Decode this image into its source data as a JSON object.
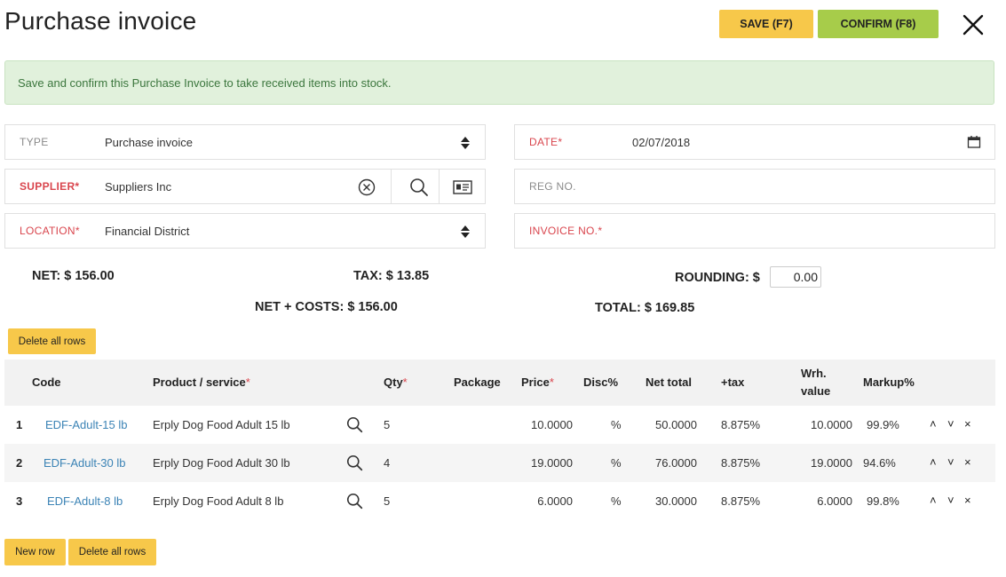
{
  "header": {
    "title": "Purchase invoice",
    "save_label": "SAVE (F7)",
    "confirm_label": "CONFIRM (F8)"
  },
  "alert": {
    "text": "Save and confirm this Purchase Invoice to take received items into stock."
  },
  "form": {
    "type": {
      "label": "TYPE",
      "value": "Purchase invoice"
    },
    "supplier": {
      "label": "SUPPLIER",
      "required_mark": "*",
      "value": "Suppliers Inc"
    },
    "location": {
      "label": "LOCATION",
      "required_mark": "*",
      "value": "Financial District"
    },
    "date": {
      "label": "DATE",
      "required_mark": "*",
      "value": "02/07/2018"
    },
    "reg_no": {
      "label": "REG NO.",
      "value": ""
    },
    "invoice_no": {
      "label": "INVOICE NO.",
      "required_mark": "*",
      "value": ""
    }
  },
  "totals": {
    "net": "NET: $ 156.00",
    "tax": "TAX: $ 13.85",
    "rounding_label": "ROUNDING: $",
    "rounding_value": "0.00",
    "net_costs": "NET + COSTS: $ 156.00",
    "total": "TOTAL: $ 169.85"
  },
  "buttons": {
    "delete_all_top": "Delete all rows",
    "new_row": "New row",
    "delete_all_bottom": "Delete all rows"
  },
  "table": {
    "headers": {
      "code": "Code",
      "product": "Product / service",
      "qty": "Qty",
      "package": "Package",
      "price": "Price",
      "disc": "Disc%",
      "net_total": "Net total",
      "tax": "+tax",
      "wrh_value_1": "Wrh.",
      "wrh_value_2": "value",
      "markup": "Markup%",
      "required_mark": "*"
    },
    "rows": [
      {
        "num": "1",
        "code": "EDF-Adult-15 lb",
        "product": "Erply Dog Food Adult 15 lb",
        "qty": "5",
        "price": "10.0000",
        "disc": "%",
        "net_total": "50.0000",
        "tax": "8.875%",
        "wrh_value": "10.0000",
        "markup": "99.9%"
      },
      {
        "num": "2",
        "code": "EDF-Adult-30 lb",
        "product": "Erply Dog Food Adult 30 lb",
        "qty": "4",
        "price": "19.0000",
        "disc": "%",
        "net_total": "76.0000",
        "tax": "8.875%",
        "wrh_value": "19.0000",
        "markup": "94.6%"
      },
      {
        "num": "3",
        "code": "EDF-Adult-8 lb",
        "product": "Erply Dog Food Adult 8 lb",
        "qty": "5",
        "price": "6.0000",
        "disc": "%",
        "net_total": "30.0000",
        "tax": "8.875%",
        "wrh_value": "6.0000",
        "markup": "99.8%"
      }
    ],
    "row_actions": {
      "up": "˄",
      "down": "˅",
      "remove": "×"
    }
  },
  "icons": {
    "close": "close-icon",
    "calendar": "calendar-icon",
    "clear": "clear-circle-icon",
    "search": "search-icon",
    "card": "id-card-icon",
    "sort": "updown-arrows-icon"
  },
  "colors": {
    "save_button": "#f7c84a",
    "confirm_button": "#a7cc4a",
    "alert_bg": "#e1f1dc",
    "alert_text": "#3b763d",
    "required": "#d9454d",
    "link": "#3b83b5"
  }
}
